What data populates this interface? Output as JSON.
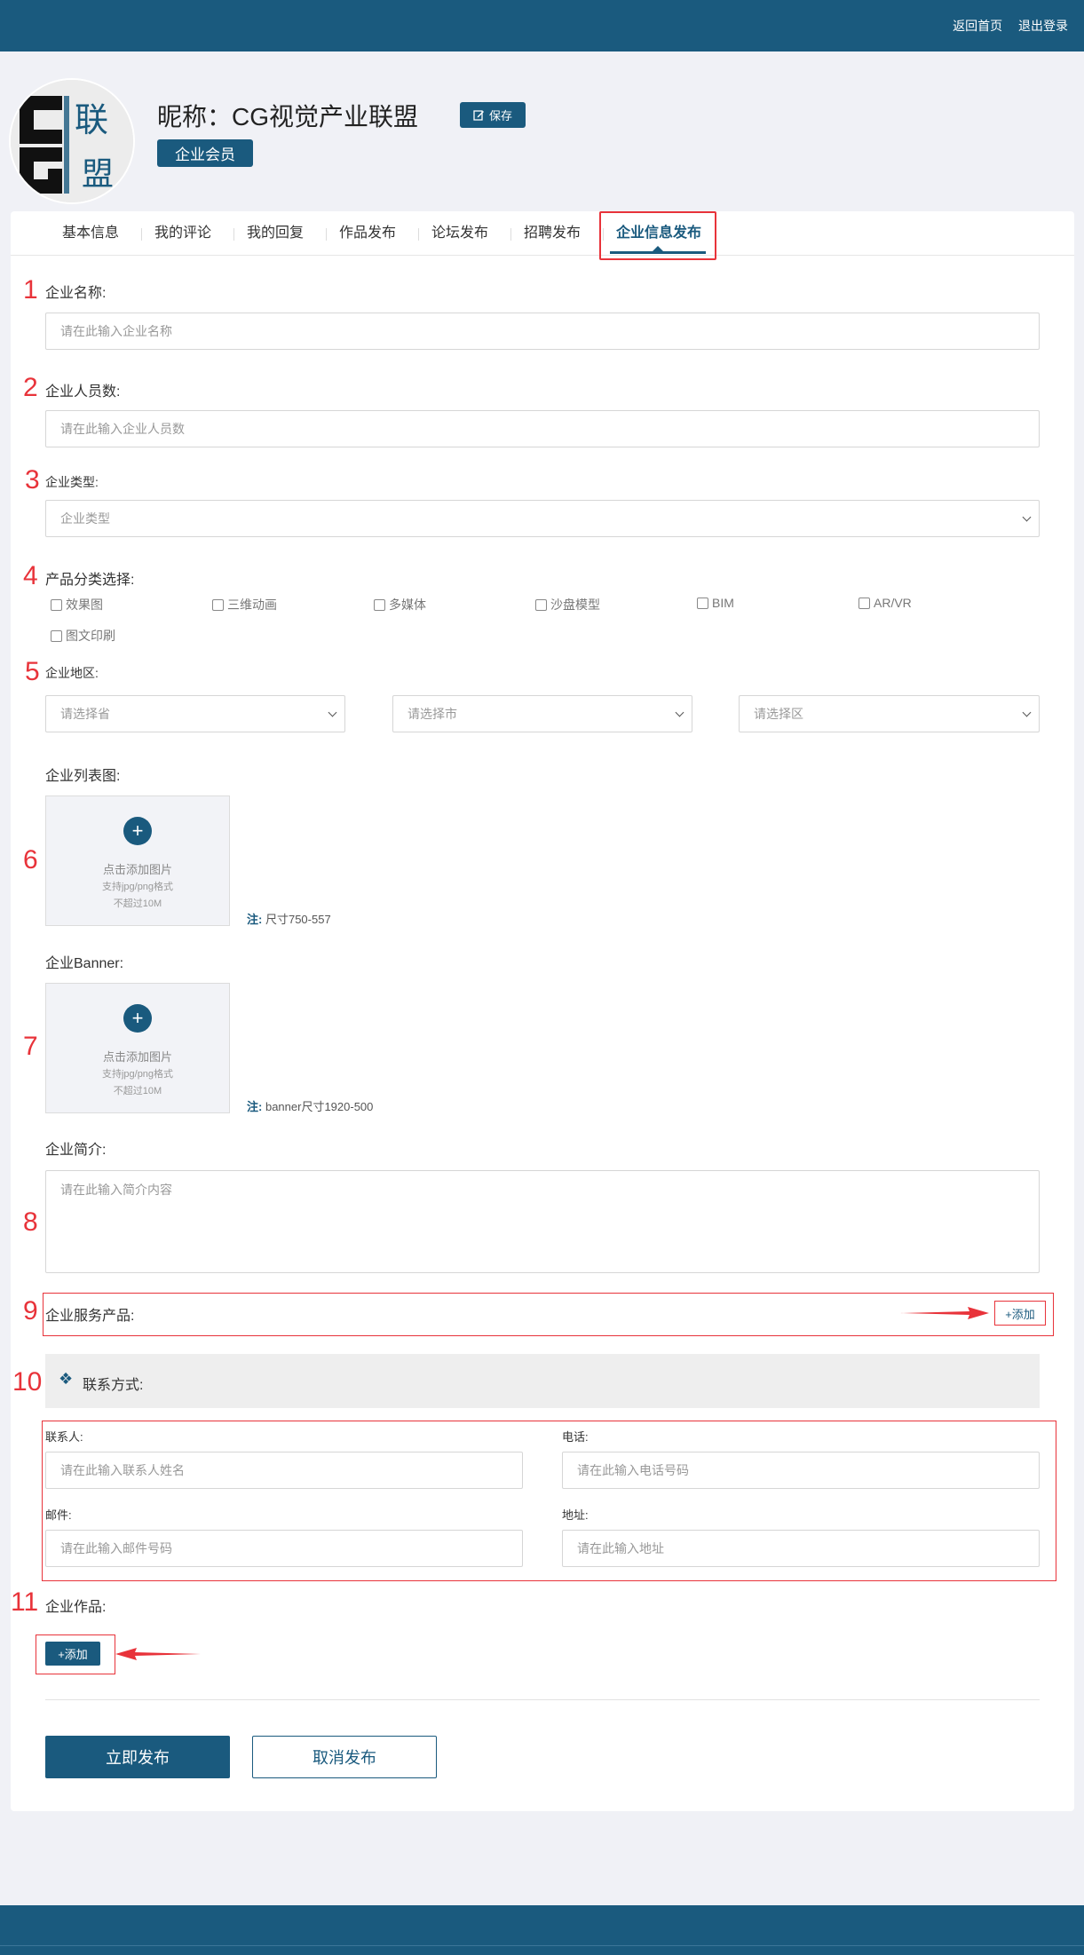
{
  "header": {
    "home_link": "返回首页",
    "logout_link": "退出登录"
  },
  "profile": {
    "avatar_text": [
      "联",
      "盟"
    ],
    "nickname": "昵称：CG视觉产业联盟",
    "save_label": "保存",
    "member_badge": "企业会员"
  },
  "tabs": [
    "基本信息",
    "我的评论",
    "我的回复",
    "作品发布",
    "论坛发布",
    "招聘发布",
    "企业信息发布"
  ],
  "active_tab": "企业信息发布",
  "annotation_numbers": [
    "1",
    "2",
    "3",
    "4",
    "5",
    "6",
    "7",
    "8",
    "9",
    "10",
    "11"
  ],
  "form": {
    "company_name": {
      "label": "企业名称:",
      "placeholder": "请在此输入企业名称"
    },
    "staff_count": {
      "label": "企业人员数:",
      "placeholder": "请在此输入企业人员数"
    },
    "company_type": {
      "label": "企业类型:",
      "placeholder": "企业类型"
    },
    "product_category": {
      "label": "产品分类选择:",
      "options": [
        "效果图",
        "三维动画",
        "多媒体",
        "沙盘模型",
        "BIM",
        "AR/VR",
        "图文印刷"
      ]
    },
    "region": {
      "label": "企业地区:",
      "province": "请选择省",
      "city": "请选择市",
      "district": "请选择区"
    },
    "list_image": {
      "label": "企业列表图:",
      "upload_text": "点击添加图片",
      "format_text": "支持jpg/png格式",
      "size_text": "不超过10M",
      "note_prefix": "注:",
      "note": "尺寸750-557"
    },
    "banner": {
      "label": "企业Banner:",
      "upload_text": "点击添加图片",
      "format_text": "支持jpg/png格式",
      "size_text": "不超过10M",
      "note_prefix": "注:",
      "note": "banner尺寸1920-500"
    },
    "intro": {
      "label": "企业简介:",
      "placeholder": "请在此输入简介内容"
    },
    "services": {
      "label": "企业服务产品:",
      "add_label": "+添加"
    },
    "contact": {
      "title": "联系方式:",
      "icon": "diamond-cluster-icon",
      "person": {
        "label": "联系人:",
        "placeholder": "请在此输入联系人姓名"
      },
      "phone": {
        "label": "电话:",
        "placeholder": "请在此输入电话号码"
      },
      "email": {
        "label": "邮件:",
        "placeholder": "请在此输入邮件号码"
      },
      "address": {
        "label": "地址:",
        "placeholder": "请在此输入地址"
      }
    },
    "works": {
      "label": "企业作品:",
      "add_label": "+添加"
    },
    "publish_label": "立即发布",
    "cancel_label": "取消发布"
  },
  "colors": {
    "primary": "#1a5a7e",
    "annotation": "#e8333a",
    "page_bg": "#f0f1f6"
  }
}
